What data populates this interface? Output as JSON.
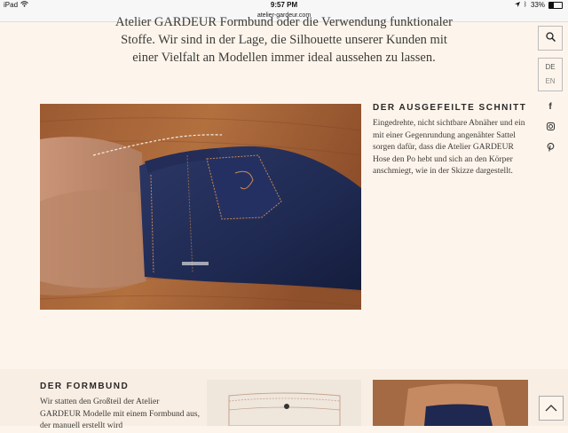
{
  "status_bar": {
    "device": "iPad",
    "time": "9:57 PM",
    "battery": "33%",
    "battery_level": 0.33
  },
  "browser": {
    "url": "atelier-gardeur.com"
  },
  "intro": {
    "text": "Atelier GARDEUR Formbund oder die Verwendung funktionaler Stoffe. Wir sind in der Lage, die Silhouette unserer Kunden mit einer Vielfalt an Modellen immer ideal aussehen zu lassen."
  },
  "section_cut": {
    "heading": "DER AUSGEFEILTE SCHNITT",
    "body": "Eingedrehte, nicht sichtbare Abnäher und ein mit einer Gegenrundung angenähter Sattel sorgen dafür, dass die Atelier GARDEUR Hose den Po hebt und sich an den Körper anschmiegt, wie in der Skizze dargestellt."
  },
  "section_waistband": {
    "heading": "DER FORMBUND",
    "body": "Wir statten den Großteil der Atelier GARDEUR Modelle mit einem Formbund aus, der manuell erstellt wird"
  },
  "side_nav": {
    "search_icon": "search-icon",
    "languages": [
      "DE",
      "EN"
    ],
    "active_language": "EN",
    "social": [
      {
        "name": "facebook-icon",
        "glyph": "f"
      },
      {
        "name": "instagram-icon",
        "glyph": "◙"
      },
      {
        "name": "pinterest-icon",
        "glyph": "P"
      }
    ],
    "to_top_icon": "chevron-up-icon"
  }
}
